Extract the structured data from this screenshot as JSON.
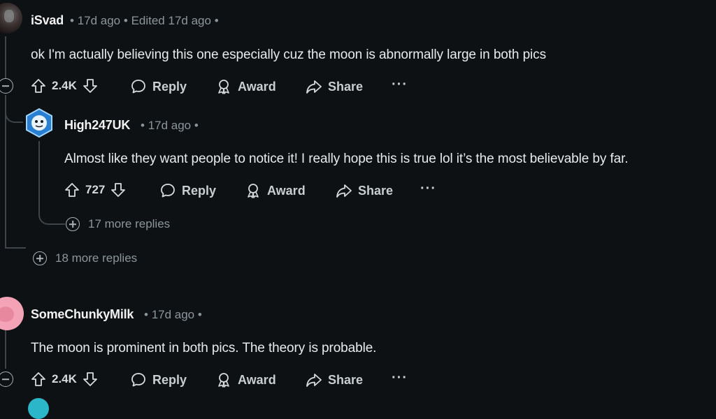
{
  "comments": [
    {
      "username": "iSvad",
      "time": "17d ago",
      "edited": "Edited 17d ago",
      "body": "ok I'm actually believing this one especially cuz the moon is abnormally large in both pics",
      "votes": "2.4K",
      "more_replies": "18 more replies",
      "reply": {
        "username": "High247UK",
        "time": "17d ago",
        "body": "Almost like they want people to notice it! I really hope this is true lol it’s the most believable by far.",
        "votes": "727",
        "more_replies": "17 more replies"
      }
    },
    {
      "username": "SomeChunkyMilk",
      "time": "17d ago",
      "body": "The moon is prominent in both pics. The theory is probable.",
      "votes": "2.4K"
    }
  ],
  "actions": {
    "reply": "Reply",
    "award": "Award",
    "share": "Share",
    "more": "···"
  },
  "separators": {
    "dot": "•"
  },
  "colors": {
    "background": "#0e1113",
    "text": "#d7dadc",
    "muted": "#8b969c",
    "thread_line": "#3e4447"
  }
}
